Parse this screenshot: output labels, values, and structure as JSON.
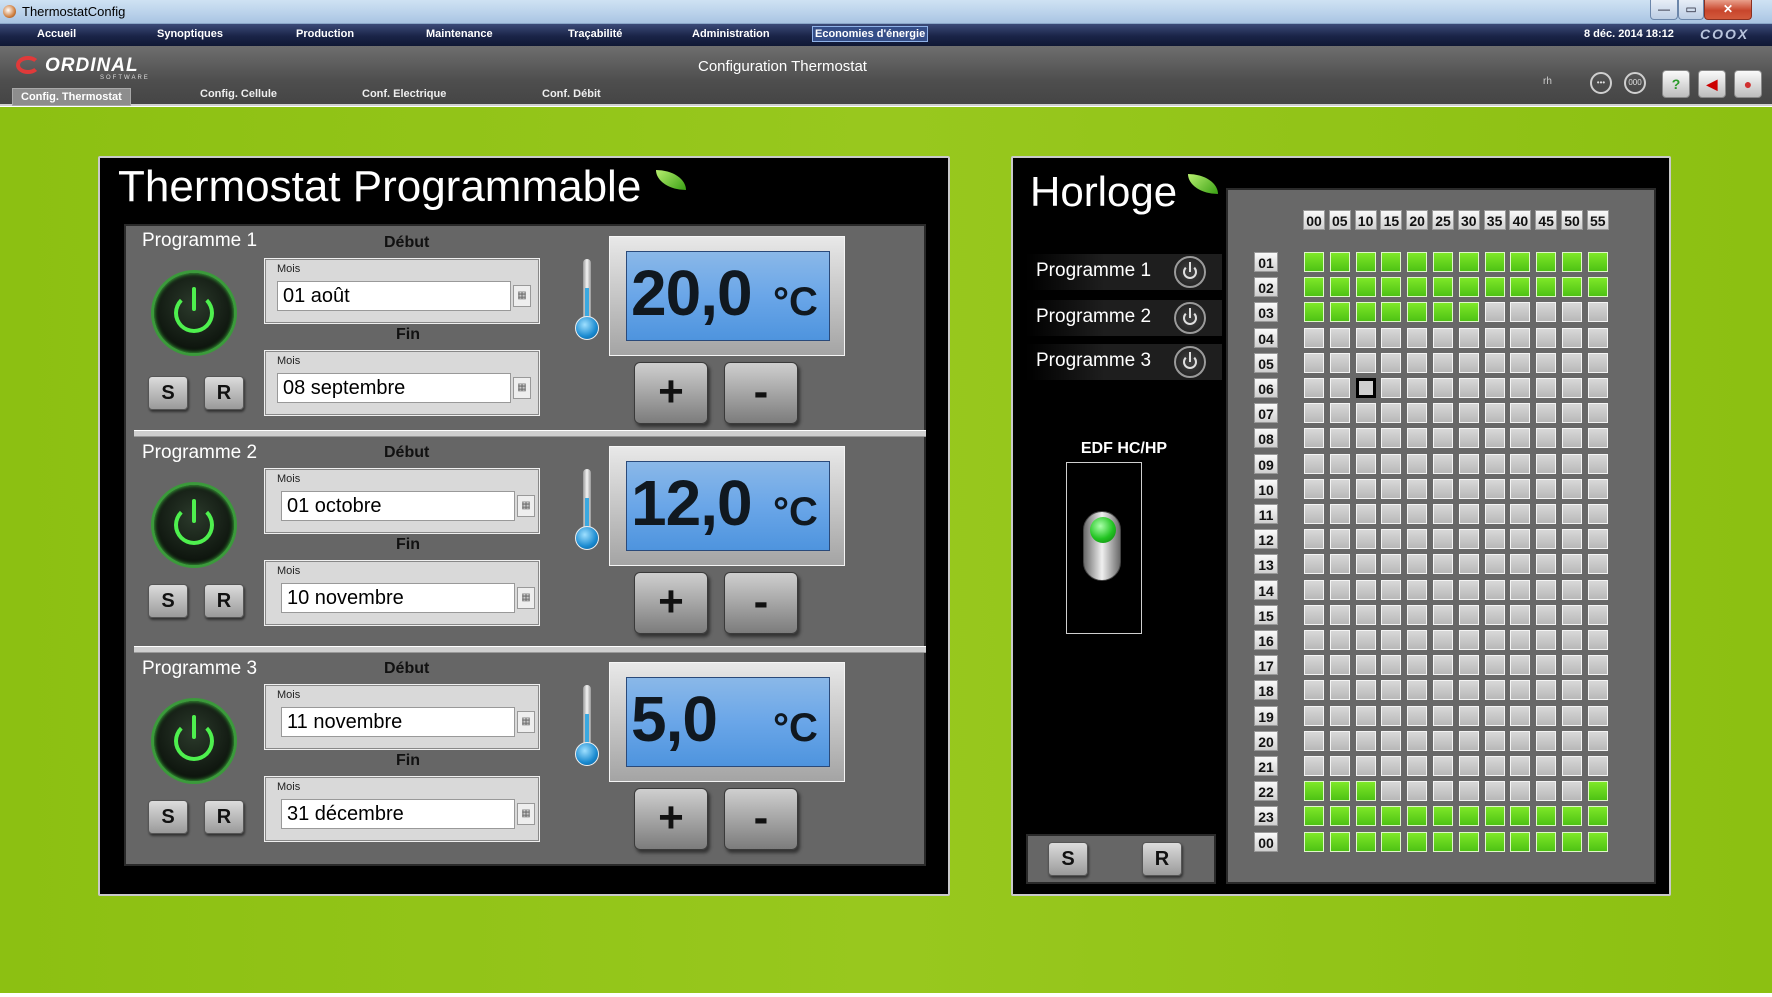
{
  "window": {
    "title": "ThermostatConfig"
  },
  "menu": {
    "items": [
      "Accueil",
      "Synoptiques",
      "Production",
      "Maintenance",
      "Traçabilité",
      "Administration",
      "Economies d'énergie"
    ],
    "datetime": "8 déc. 2014 18:12",
    "brand": "COOX"
  },
  "toolbar": {
    "logo_name": "ORDINAL",
    "logo_sub": "SOFTWARE",
    "title": "Configuration Thermostat",
    "tabs": [
      "Config. Thermostat",
      "Config. Cellule",
      "Conf. Electrique",
      "Conf. Débit"
    ],
    "user": "rh",
    "icons": [
      "minus-circle-icon",
      "zero-circle-icon",
      "help-icon",
      "speaker-mute-icon",
      "balloons-icon"
    ],
    "counter": "000"
  },
  "thermostat": {
    "title": "Thermostat Programmable",
    "debut_label": "Début",
    "fin_label": "Fin",
    "mois_label": "Mois",
    "s_label": "S",
    "r_label": "R",
    "unit": "°C",
    "plus_label": "+",
    "minus_label": "-",
    "programs": [
      {
        "name": "Programme 1",
        "debut": "01 août",
        "fin": "08 septembre",
        "temp": "20,0"
      },
      {
        "name": "Programme 2",
        "debut": "01 octobre",
        "fin": "10 novembre",
        "temp": "12,0"
      },
      {
        "name": "Programme 3",
        "debut": "11 novembre",
        "fin": "31 décembre",
        "temp": "5,0"
      }
    ]
  },
  "horloge": {
    "title": "Horloge",
    "programs": [
      "Programme 1",
      "Programme 2",
      "Programme 3"
    ],
    "edf_label": "EDF HC/HP",
    "edf_on": true,
    "s_label": "S",
    "r_label": "R",
    "minutes": [
      "00",
      "05",
      "10",
      "15",
      "20",
      "25",
      "30",
      "35",
      "40",
      "45",
      "50",
      "55"
    ],
    "hours": [
      "01",
      "02",
      "03",
      "04",
      "05",
      "06",
      "07",
      "08",
      "09",
      "10",
      "11",
      "12",
      "13",
      "14",
      "15",
      "16",
      "17",
      "18",
      "19",
      "20",
      "21",
      "22",
      "23",
      "00"
    ],
    "green_cells": {
      "01": [
        0,
        1,
        2,
        3,
        4,
        5,
        6,
        7,
        8,
        9,
        10,
        11
      ],
      "02": [
        0,
        1,
        2,
        3,
        4,
        5,
        6,
        7,
        8,
        9,
        10,
        11
      ],
      "03": [
        0,
        1,
        2,
        3,
        4,
        5,
        6
      ],
      "22": [
        0,
        1,
        2,
        11
      ],
      "23": [
        0,
        1,
        2,
        3,
        4,
        5,
        6,
        7,
        8,
        9,
        10,
        11
      ],
      "00": [
        0,
        1,
        2,
        3,
        4,
        5,
        6,
        7,
        8,
        9,
        10,
        11
      ]
    },
    "selected_cell": {
      "hour": "06",
      "minute": "10"
    }
  },
  "colors": {
    "background": "#8cc012",
    "active_cell": "#5ed01a",
    "lcd": "#6aa6e8"
  }
}
